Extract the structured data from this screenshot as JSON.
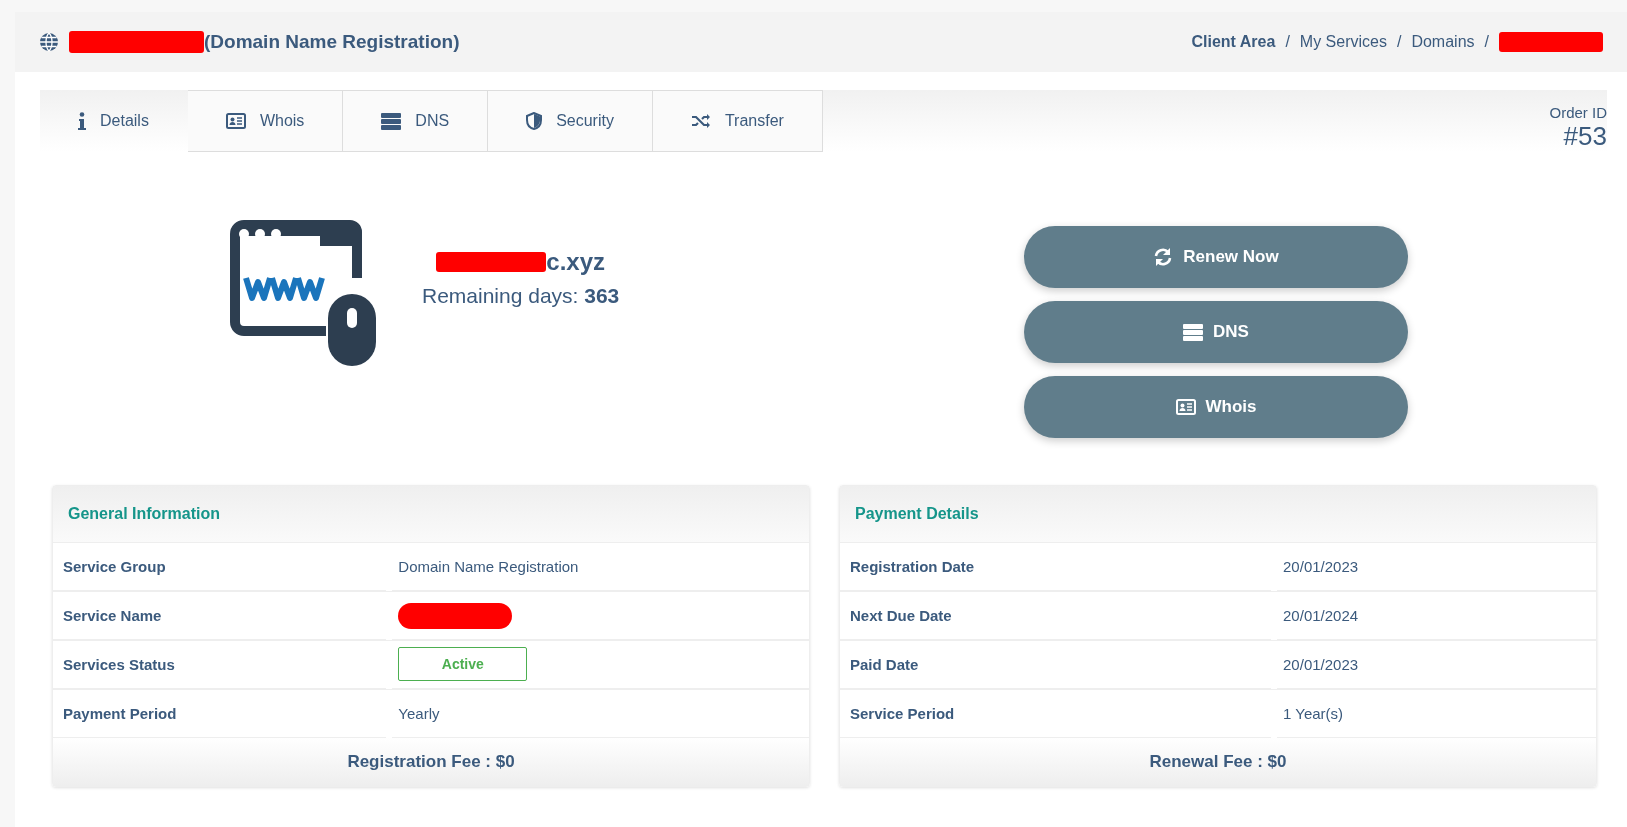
{
  "header": {
    "title": "(Domain Name Registration)",
    "title_redacted": true,
    "breadcrumb_separator": "/",
    "breadcrumb": [
      {
        "kind": "strong",
        "label": "Client Area"
      },
      {
        "kind": "link",
        "label": "My Services"
      },
      {
        "kind": "link",
        "label": "Domains"
      },
      {
        "kind": "redaction"
      }
    ]
  },
  "tabs": [
    {
      "label": "Details",
      "kind": "info",
      "selected": true
    },
    {
      "label": "Whois",
      "kind": "card",
      "selected": false
    },
    {
      "label": "DNS",
      "kind": "server",
      "selected": false
    },
    {
      "label": "Security",
      "kind": "shield",
      "selected": false
    },
    {
      "label": "Transfer",
      "kind": "shuffle",
      "selected": false
    }
  ],
  "order": {
    "label": "Order ID",
    "value": "#53"
  },
  "domain": {
    "name": "c.xyz",
    "name_redacted": true,
    "remaining_label": "Remaining days:",
    "remaining_value": "363"
  },
  "actions": [
    {
      "label": "Renew Now",
      "kind": "refresh"
    },
    {
      "label": "DNS",
      "kind": "server"
    },
    {
      "label": "Whois",
      "kind": "card"
    }
  ],
  "panels": [
    {
      "title": "General Information",
      "footer": "Registration Fee : $0",
      "rows": [
        {
          "label": "Service Group",
          "kind": "text",
          "value": "Domain Name Registration"
        },
        {
          "label": "Service Name",
          "kind": "redaction"
        },
        {
          "label": "Services Status",
          "kind": "badge",
          "value": "Active"
        },
        {
          "label": "Payment Period",
          "kind": "text",
          "value": "Yearly"
        }
      ]
    },
    {
      "title": "Payment Details",
      "footer": "Renewal Fee : $0",
      "rows": [
        {
          "label": "Registration Date",
          "kind": "text",
          "value": "20/01/2023"
        },
        {
          "label": "Next Due Date",
          "kind": "text",
          "value": "20/01/2024"
        },
        {
          "label": "Paid Date",
          "kind": "text",
          "value": "20/01/2023"
        },
        {
          "label": "Service Period",
          "kind": "text",
          "value": "1 Year(s)"
        }
      ]
    }
  ]
}
